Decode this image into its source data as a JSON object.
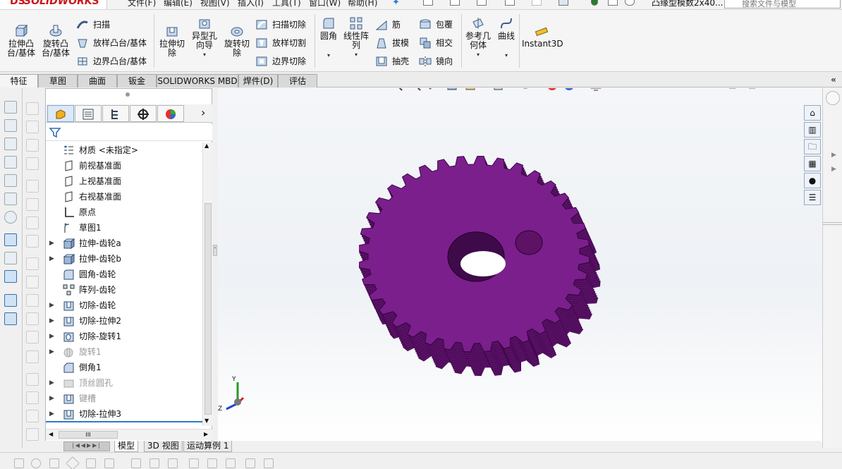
{
  "app": {
    "logo_ds": "DS",
    "logo_text": "SOLIDWORKS"
  },
  "menu": [
    "文件(F)",
    "编辑(E)",
    "视图(V)",
    "插入(I)",
    "工具(T)",
    "窗口(W)",
    "帮助(H)"
  ],
  "document_title": "凸缘型模数2x40...",
  "search": {
    "placeholder": "搜索文件与模型"
  },
  "ribbon": {
    "big": [
      {
        "label": "拉伸凸\n台/基体"
      },
      {
        "label": "旋转凸\n台/基体"
      },
      {
        "label": "拉伸切\n除"
      },
      {
        "label": "异型孔\n向导"
      },
      {
        "label": "旋转切\n除"
      },
      {
        "label": "圆角"
      },
      {
        "label": "线性阵\n列"
      },
      {
        "label": "参考几\n何体"
      },
      {
        "label": "曲线"
      },
      {
        "label": "Instant3D"
      }
    ],
    "small": [
      {
        "label": "扫描"
      },
      {
        "label": "放样凸台/基体"
      },
      {
        "label": "边界凸台/基体"
      },
      {
        "label": "扫描切除"
      },
      {
        "label": "放样切割"
      },
      {
        "label": "边界切除"
      },
      {
        "label": "筋"
      },
      {
        "label": "拔模"
      },
      {
        "label": "抽壳"
      },
      {
        "label": "包覆"
      },
      {
        "label": "相交"
      },
      {
        "label": "镜向"
      }
    ]
  },
  "tabs": [
    {
      "label": "特征",
      "active": true
    },
    {
      "label": "草图"
    },
    {
      "label": "曲面"
    },
    {
      "label": "钣金"
    },
    {
      "label": "SOLIDWORKS MBD"
    },
    {
      "label": "焊件(D)"
    },
    {
      "label": "评估"
    }
  ],
  "feature_tree": {
    "items": [
      {
        "label": "材质 <未指定>",
        "icon": "material-icon",
        "expand": false,
        "dim": false
      },
      {
        "label": "前视基准面",
        "icon": "plane-icon",
        "expand": false,
        "dim": false
      },
      {
        "label": "上视基准面",
        "icon": "plane-icon",
        "expand": false,
        "dim": false
      },
      {
        "label": "右视基准面",
        "icon": "plane-icon",
        "expand": false,
        "dim": false
      },
      {
        "label": "原点",
        "icon": "origin-icon",
        "expand": false,
        "dim": false
      },
      {
        "label": "草图1",
        "icon": "sketch-icon",
        "expand": false,
        "dim": false
      },
      {
        "label": "拉伸-齿轮a",
        "icon": "extrude-icon",
        "expand": true,
        "dim": false
      },
      {
        "label": "拉伸-齿轮b",
        "icon": "extrude-icon",
        "expand": true,
        "dim": false
      },
      {
        "label": "圆角-齿轮",
        "icon": "fillet-icon",
        "expand": false,
        "dim": false
      },
      {
        "label": "阵列-齿轮",
        "icon": "pattern-icon",
        "expand": false,
        "dim": false
      },
      {
        "label": "切除-齿轮",
        "icon": "cut-icon",
        "expand": true,
        "dim": false
      },
      {
        "label": "切除-拉伸2",
        "icon": "cut-icon",
        "expand": true,
        "dim": false
      },
      {
        "label": "切除-旋转1",
        "icon": "revolve-cut-icon",
        "expand": true,
        "dim": false
      },
      {
        "label": "旋转1",
        "icon": "revolve-icon",
        "expand": true,
        "dim": true
      },
      {
        "label": "倒角1",
        "icon": "chamfer-icon",
        "expand": false,
        "dim": false
      },
      {
        "label": "顶丝圆孔",
        "icon": "folder-icon",
        "expand": true,
        "dim": true
      },
      {
        "label": "键槽",
        "icon": "cut-icon",
        "expand": true,
        "dim": true
      },
      {
        "label": "切除-拉伸3",
        "icon": "cut-icon",
        "expand": true,
        "dim": false
      }
    ],
    "hscroll_label": "III"
  },
  "bottom_tabs": [
    {
      "label": "模型",
      "active": true
    },
    {
      "label": "3D 视图"
    },
    {
      "label": "运动算例 1"
    }
  ],
  "triad": {
    "y": "Y",
    "z": "Z"
  },
  "colors": {
    "gear": "#7b1f8c",
    "gear_dark": "#5b1168",
    "accent": "#2d7bd1",
    "brand": "#c9161b"
  }
}
